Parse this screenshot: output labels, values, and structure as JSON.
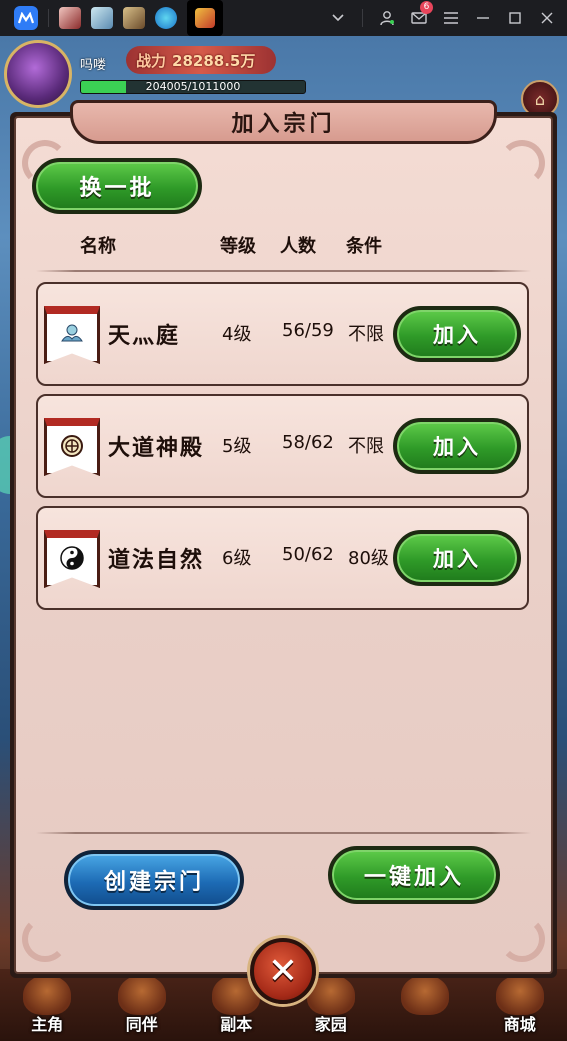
{
  "titlebar": {
    "notification_count": "6"
  },
  "hud": {
    "player_name": "吗喽",
    "power_label": "战力",
    "power_value": "28288.5万",
    "exp_text": "204005/1011000",
    "exp_fraction": 0.2
  },
  "dialog": {
    "title": "加入宗门",
    "refresh_label": "换一批",
    "columns": {
      "name": "名称",
      "level": "等级",
      "members": "人数",
      "condition": "条件"
    },
    "sects": [
      {
        "name": "天灬庭",
        "level": "4级",
        "members": "56/59",
        "condition": "不限",
        "join_label": "加入",
        "emblem": "cloud-emblem"
      },
      {
        "name": "大道神殿",
        "level": "5级",
        "members": "58/62",
        "condition": "不限",
        "join_label": "加入",
        "emblem": "seal-emblem"
      },
      {
        "name": "道法自然",
        "level": "6级",
        "members": "50/62",
        "condition": "80级",
        "join_label": "加入",
        "emblem": "yin-yang-emblem"
      }
    ],
    "create_label": "创建宗门",
    "quick_join_label": "一键加入",
    "close_glyph": "✕"
  },
  "bottom_nav": [
    {
      "label": "主角"
    },
    {
      "label": "同伴"
    },
    {
      "label": "副本"
    },
    {
      "label": "家园"
    },
    {
      "label": ""
    },
    {
      "label": "商城"
    }
  ],
  "colors": {
    "green_button": "#2f9a28",
    "blue_button": "#1d6bb5",
    "panel": "#f4dcd4",
    "banner_red": "#b22a22"
  }
}
